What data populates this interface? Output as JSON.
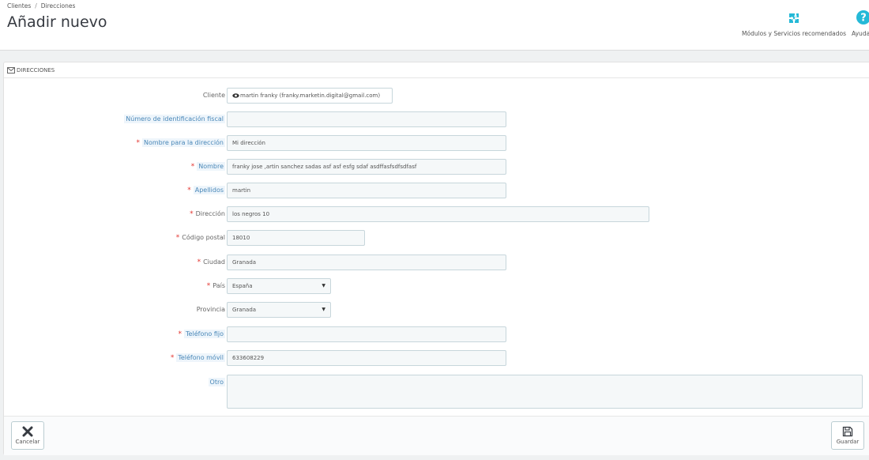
{
  "header": {
    "breadcrumb": [
      "Clientes",
      "Direcciones"
    ],
    "breadcrumb_sep": "/",
    "title": "Añadir nuevo",
    "toolbar": [
      {
        "label": "Módulos y Servicios recomendados",
        "icon": "puzzle-icon"
      },
      {
        "label": "Ayuda",
        "icon": "help-icon"
      }
    ]
  },
  "panel": {
    "heading": "DIRECCIONES",
    "heading_icon": "envelope-icon"
  },
  "form": {
    "customer": {
      "label": "Cliente",
      "value": "martin franky (franky.marketin.digital@gmail.com)",
      "icon": "eye-icon"
    },
    "vat_number": {
      "label": "Número de identificación fiscal",
      "value": ""
    },
    "alias": {
      "label": "Nombre para la dirección",
      "value": "Mi dirección"
    },
    "firstname": {
      "label": "Nombre",
      "value": "franky jose ,artin sanchez sadas  asf asf  esfg sdaf   asdffasfsdfsdfasf"
    },
    "lastname": {
      "label": "Apellidos",
      "value": "martin"
    },
    "address": {
      "label": "Dirección",
      "value": "los negros 10"
    },
    "postcode": {
      "label": "Código postal",
      "value": "18010"
    },
    "city": {
      "label": "Ciudad",
      "value": "Granada"
    },
    "country": {
      "label": "País",
      "value": "España"
    },
    "state": {
      "label": "Provincia",
      "value": "Granada"
    },
    "phone": {
      "label": "Teléfono fijo",
      "value": ""
    },
    "mobile": {
      "label": "Teléfono móvil",
      "value": "633608229"
    },
    "other": {
      "label": "Otro",
      "value": ""
    }
  },
  "footer": {
    "cancel_label": "Cancelar",
    "save_label": "Guardar"
  },
  "colors": {
    "accent": "#25b9d7",
    "required": "#e3342f",
    "hint_text": "#4a88b8"
  }
}
